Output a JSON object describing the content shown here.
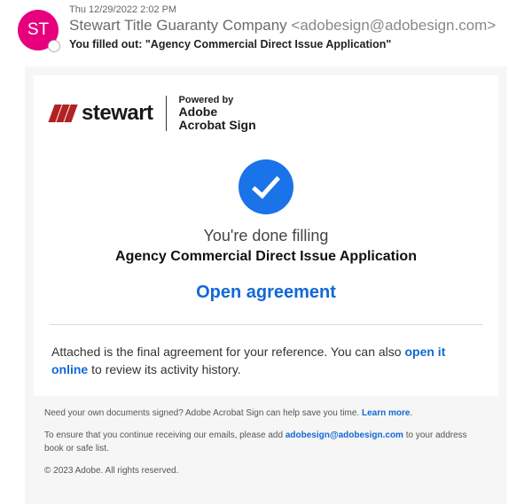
{
  "header": {
    "avatar_initials": "ST",
    "timestamp": "Thu 12/29/2022 2:02 PM",
    "sender_name": "Stewart Title Guaranty Company",
    "sender_email": "<adobesign@adobesign.com>",
    "subject": "You filled out: \"Agency Commercial Direct Issue Application\""
  },
  "logo": {
    "stewart_brand": "stewart",
    "powered_by_label": "Powered by",
    "adobe_line1": "Adobe",
    "adobe_line2": "Acrobat Sign"
  },
  "center": {
    "done_text": "You're done filling",
    "document_name": "Agency Commercial Direct Issue Application",
    "open_agreement_label": "Open agreement"
  },
  "attached": {
    "prefix": "Attached is the final agreement for your reference. You can also ",
    "link": "open it online",
    "suffix": " to review its activity history."
  },
  "footer": {
    "promo_text": "Need your own documents signed? Adobe Acrobat Sign can help save you time. ",
    "learn_more": "Learn more",
    "safelist_prefix": "To ensure that you continue receiving our emails, please add ",
    "safelist_email": "adobesign@adobesign.com",
    "safelist_suffix": " to your address book or safe list.",
    "copyright": "© 2023 Adobe. All rights reserved."
  }
}
